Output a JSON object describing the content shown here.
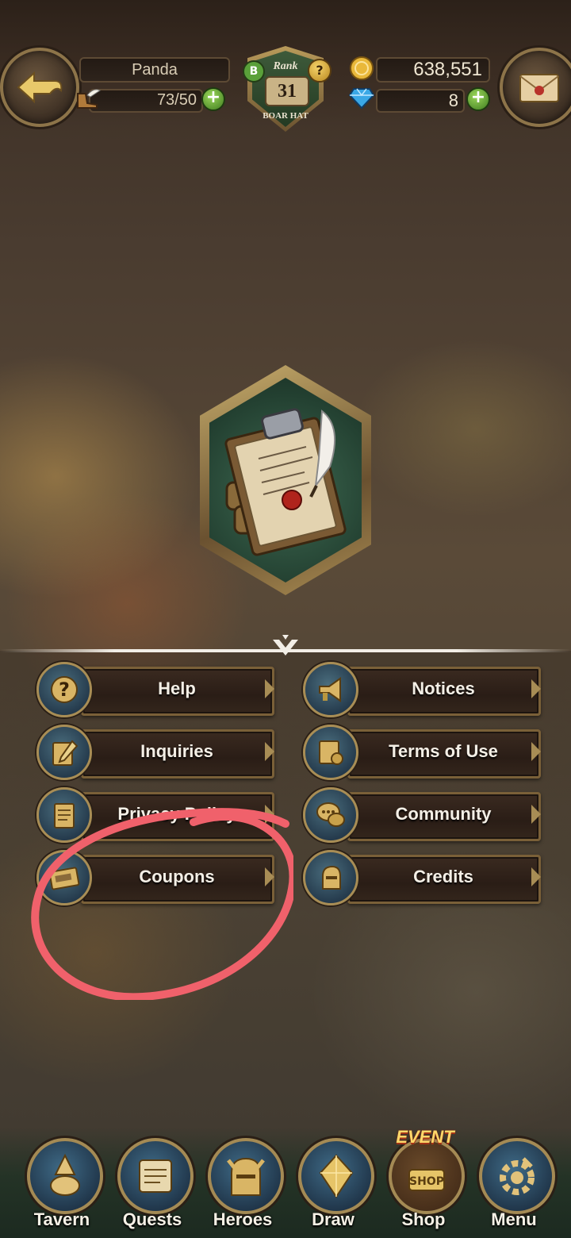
{
  "header": {
    "player_name": "Panda",
    "stamina": "73/50",
    "rank_label": "Rank",
    "rank_number": "31",
    "rank_title": "BOAR HAT",
    "gold": "638,551",
    "gems": "8"
  },
  "menu": {
    "items": [
      {
        "label": "Help",
        "icon": "question-icon"
      },
      {
        "label": "Notices",
        "icon": "megaphone-icon"
      },
      {
        "label": "Inquiries",
        "icon": "pencil-note-icon"
      },
      {
        "label": "Terms of Use",
        "icon": "scroll-stamp-icon"
      },
      {
        "label": "Privacy Policy",
        "icon": "document-icon"
      },
      {
        "label": "Community",
        "icon": "chat-bubbles-icon"
      },
      {
        "label": "Coupons",
        "icon": "coupon-ticket-icon"
      },
      {
        "label": "Credits",
        "icon": "knight-helmet-icon"
      }
    ]
  },
  "nav": {
    "items": [
      {
        "label": "Tavern"
      },
      {
        "label": "Quests"
      },
      {
        "label": "Heroes"
      },
      {
        "label": "Draw"
      },
      {
        "label": "Shop",
        "badge": "EVENT"
      },
      {
        "label": "Menu"
      }
    ]
  },
  "colors": {
    "plate_border": "#7a6038",
    "label_text": "#f4efe6",
    "annotation_red": "#f0616b",
    "plus_green": "#5fa832"
  }
}
